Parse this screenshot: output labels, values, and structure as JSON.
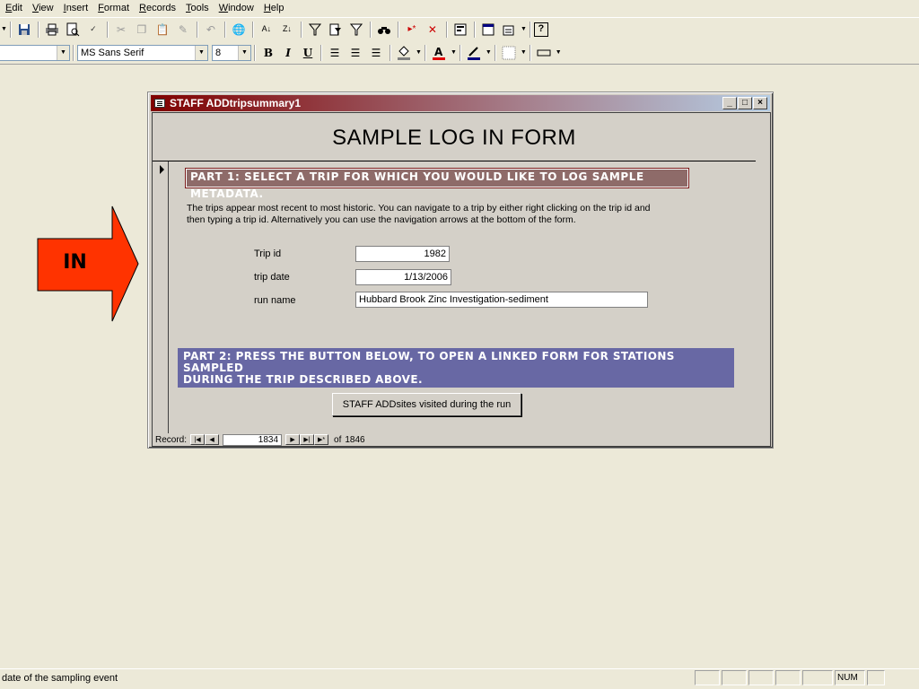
{
  "menubar": {
    "items": [
      "Edit",
      "View",
      "Insert",
      "Format",
      "Records",
      "Tools",
      "Window",
      "Help"
    ]
  },
  "format_toolbar": {
    "font_name": "MS Sans Serif",
    "font_size": "8",
    "bold_label": "B",
    "italic_label": "I",
    "underline_label": "U"
  },
  "callout": {
    "label": "IN",
    "color": "#ff3300"
  },
  "window": {
    "title": "STAFF ADDtripsummary1",
    "title_gradient_start": "#800000",
    "title_gradient_end": "#b5cde4"
  },
  "form": {
    "heading": "SAMPLE LOG IN FORM",
    "part1_label": "PART 1:  SELECT A TRIP FOR WHICH YOU WOULD LIKE TO LOG SAMPLE METADATA.",
    "description_line1": "The trips appear most recent to most historic.  You can navigate to a trip by either right clicking on the trip id and",
    "description_line2": "then typing a trip id.  Alternatively you can use the navigation arrows at the bottom of the form.",
    "fields": {
      "trip_id": {
        "label": "Trip id",
        "value": "1982"
      },
      "trip_date": {
        "label": "trip date",
        "value": "1/13/2006"
      },
      "run_name": {
        "label": "run name",
        "value": "Hubbard Brook Zinc Investigation-sediment"
      }
    },
    "part2_line1": "PART 2:  PRESS THE BUTTON BELOW, TO OPEN A LINKED FORM FOR STATIONS SAMPLED",
    "part2_line2": "DURING THE TRIP DESCRIBED ABOVE.",
    "open_button_label": "STAFF ADDsites visited during the run"
  },
  "navigation": {
    "record_label": "Record:",
    "current_record": "1834",
    "of_label": "of",
    "total_records": "1846"
  },
  "statusbar": {
    "text": "date of the sampling event",
    "num_indicator": "NUM"
  }
}
